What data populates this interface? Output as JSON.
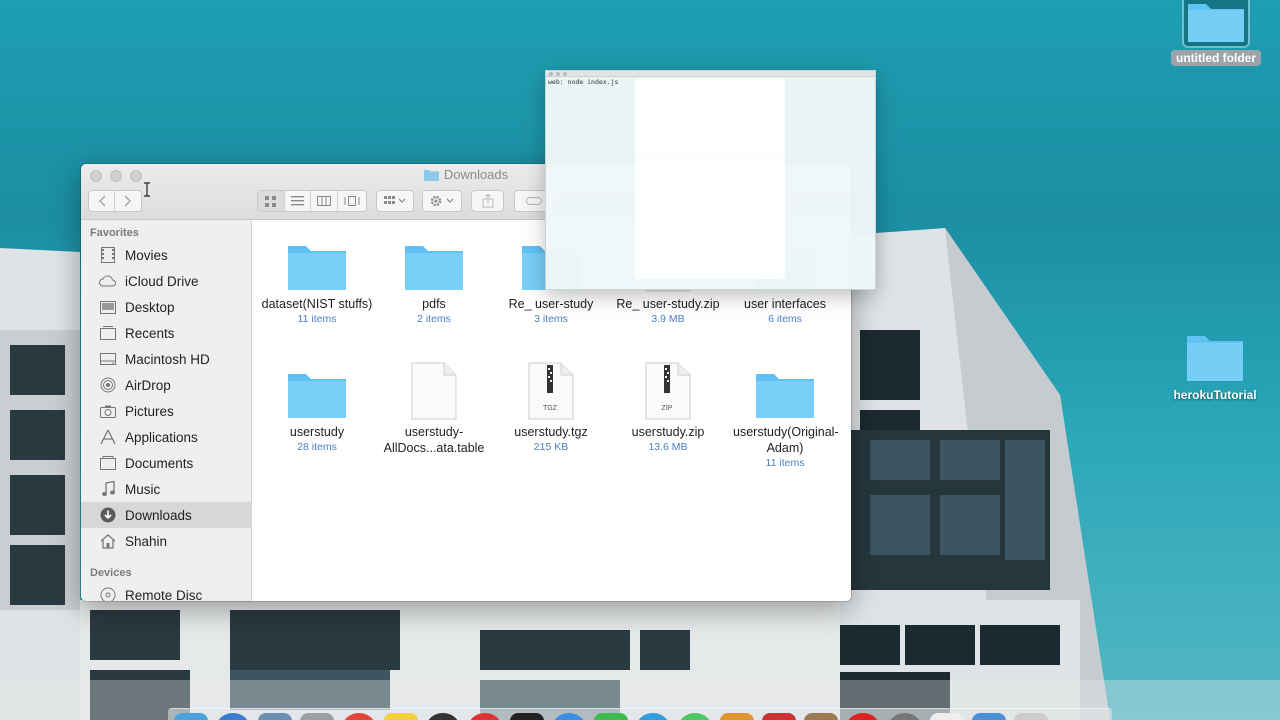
{
  "desktop": {
    "icons": [
      {
        "label": "untitled folder",
        "selected": true
      },
      {
        "label": "herokuTutorial",
        "selected": false
      }
    ]
  },
  "finder": {
    "title": "Downloads",
    "toolbar": {
      "back": "back-arrow-icon",
      "forward": "forward-arrow-icon",
      "views": [
        "icon-view-icon",
        "list-view-icon",
        "column-view-icon",
        "cover-flow-icon"
      ],
      "arrange": "arrange-icon",
      "action": "gear-icon",
      "share": "share-icon"
    },
    "sidebar": {
      "favorites_heading": "Favorites",
      "favorites": [
        {
          "label": "Movies",
          "icon": "movies-icon"
        },
        {
          "label": "iCloud Drive",
          "icon": "cloud-icon"
        },
        {
          "label": "Desktop",
          "icon": "desktop-icon"
        },
        {
          "label": "Recents",
          "icon": "recents-icon"
        },
        {
          "label": "Macintosh HD",
          "icon": "hard-drive-icon"
        },
        {
          "label": "AirDrop",
          "icon": "airdrop-icon"
        },
        {
          "label": "Pictures",
          "icon": "camera-icon"
        },
        {
          "label": "Applications",
          "icon": "applications-icon"
        },
        {
          "label": "Documents",
          "icon": "document-icon"
        },
        {
          "label": "Music",
          "icon": "music-icon"
        },
        {
          "label": "Downloads",
          "icon": "downloads-icon",
          "selected": true
        },
        {
          "label": "Shahin",
          "icon": "home-icon"
        }
      ],
      "devices_heading": "Devices",
      "devices": [
        {
          "label": "Remote Disc",
          "icon": "disc-icon"
        }
      ]
    },
    "items": [
      {
        "name": "dataset(NIST stuffs)",
        "meta": "11 items",
        "kind": "folder"
      },
      {
        "name": "pdfs",
        "meta": "2 items",
        "kind": "folder"
      },
      {
        "name": "Re_ user-study",
        "meta": "3 items",
        "kind": "folder"
      },
      {
        "name": "Re_ user-study.zip",
        "meta": "3.9 MB",
        "kind": "zip"
      },
      {
        "name": "user interfaces",
        "meta": "6 items",
        "kind": "folder"
      },
      {
        "name": "userstudy",
        "meta": "28 items",
        "kind": "folder"
      },
      {
        "name": "userstudy-AllDocs...ata.table",
        "meta": "",
        "kind": "doc"
      },
      {
        "name": "userstudy.tgz",
        "meta": "215 KB",
        "kind": "tgz",
        "badge": "TGZ"
      },
      {
        "name": "userstudy.zip",
        "meta": "13.6 MB",
        "kind": "zip",
        "badge": "ZIP"
      },
      {
        "name": "userstudy(Original-Adam)",
        "meta": "11 items",
        "kind": "folder"
      }
    ]
  },
  "preview": {
    "text": "web: node index.js"
  },
  "colors": {
    "folder": "#5fc2f4",
    "meta": "#4b7fc1",
    "desktop_bg": "#1f9eb1"
  }
}
